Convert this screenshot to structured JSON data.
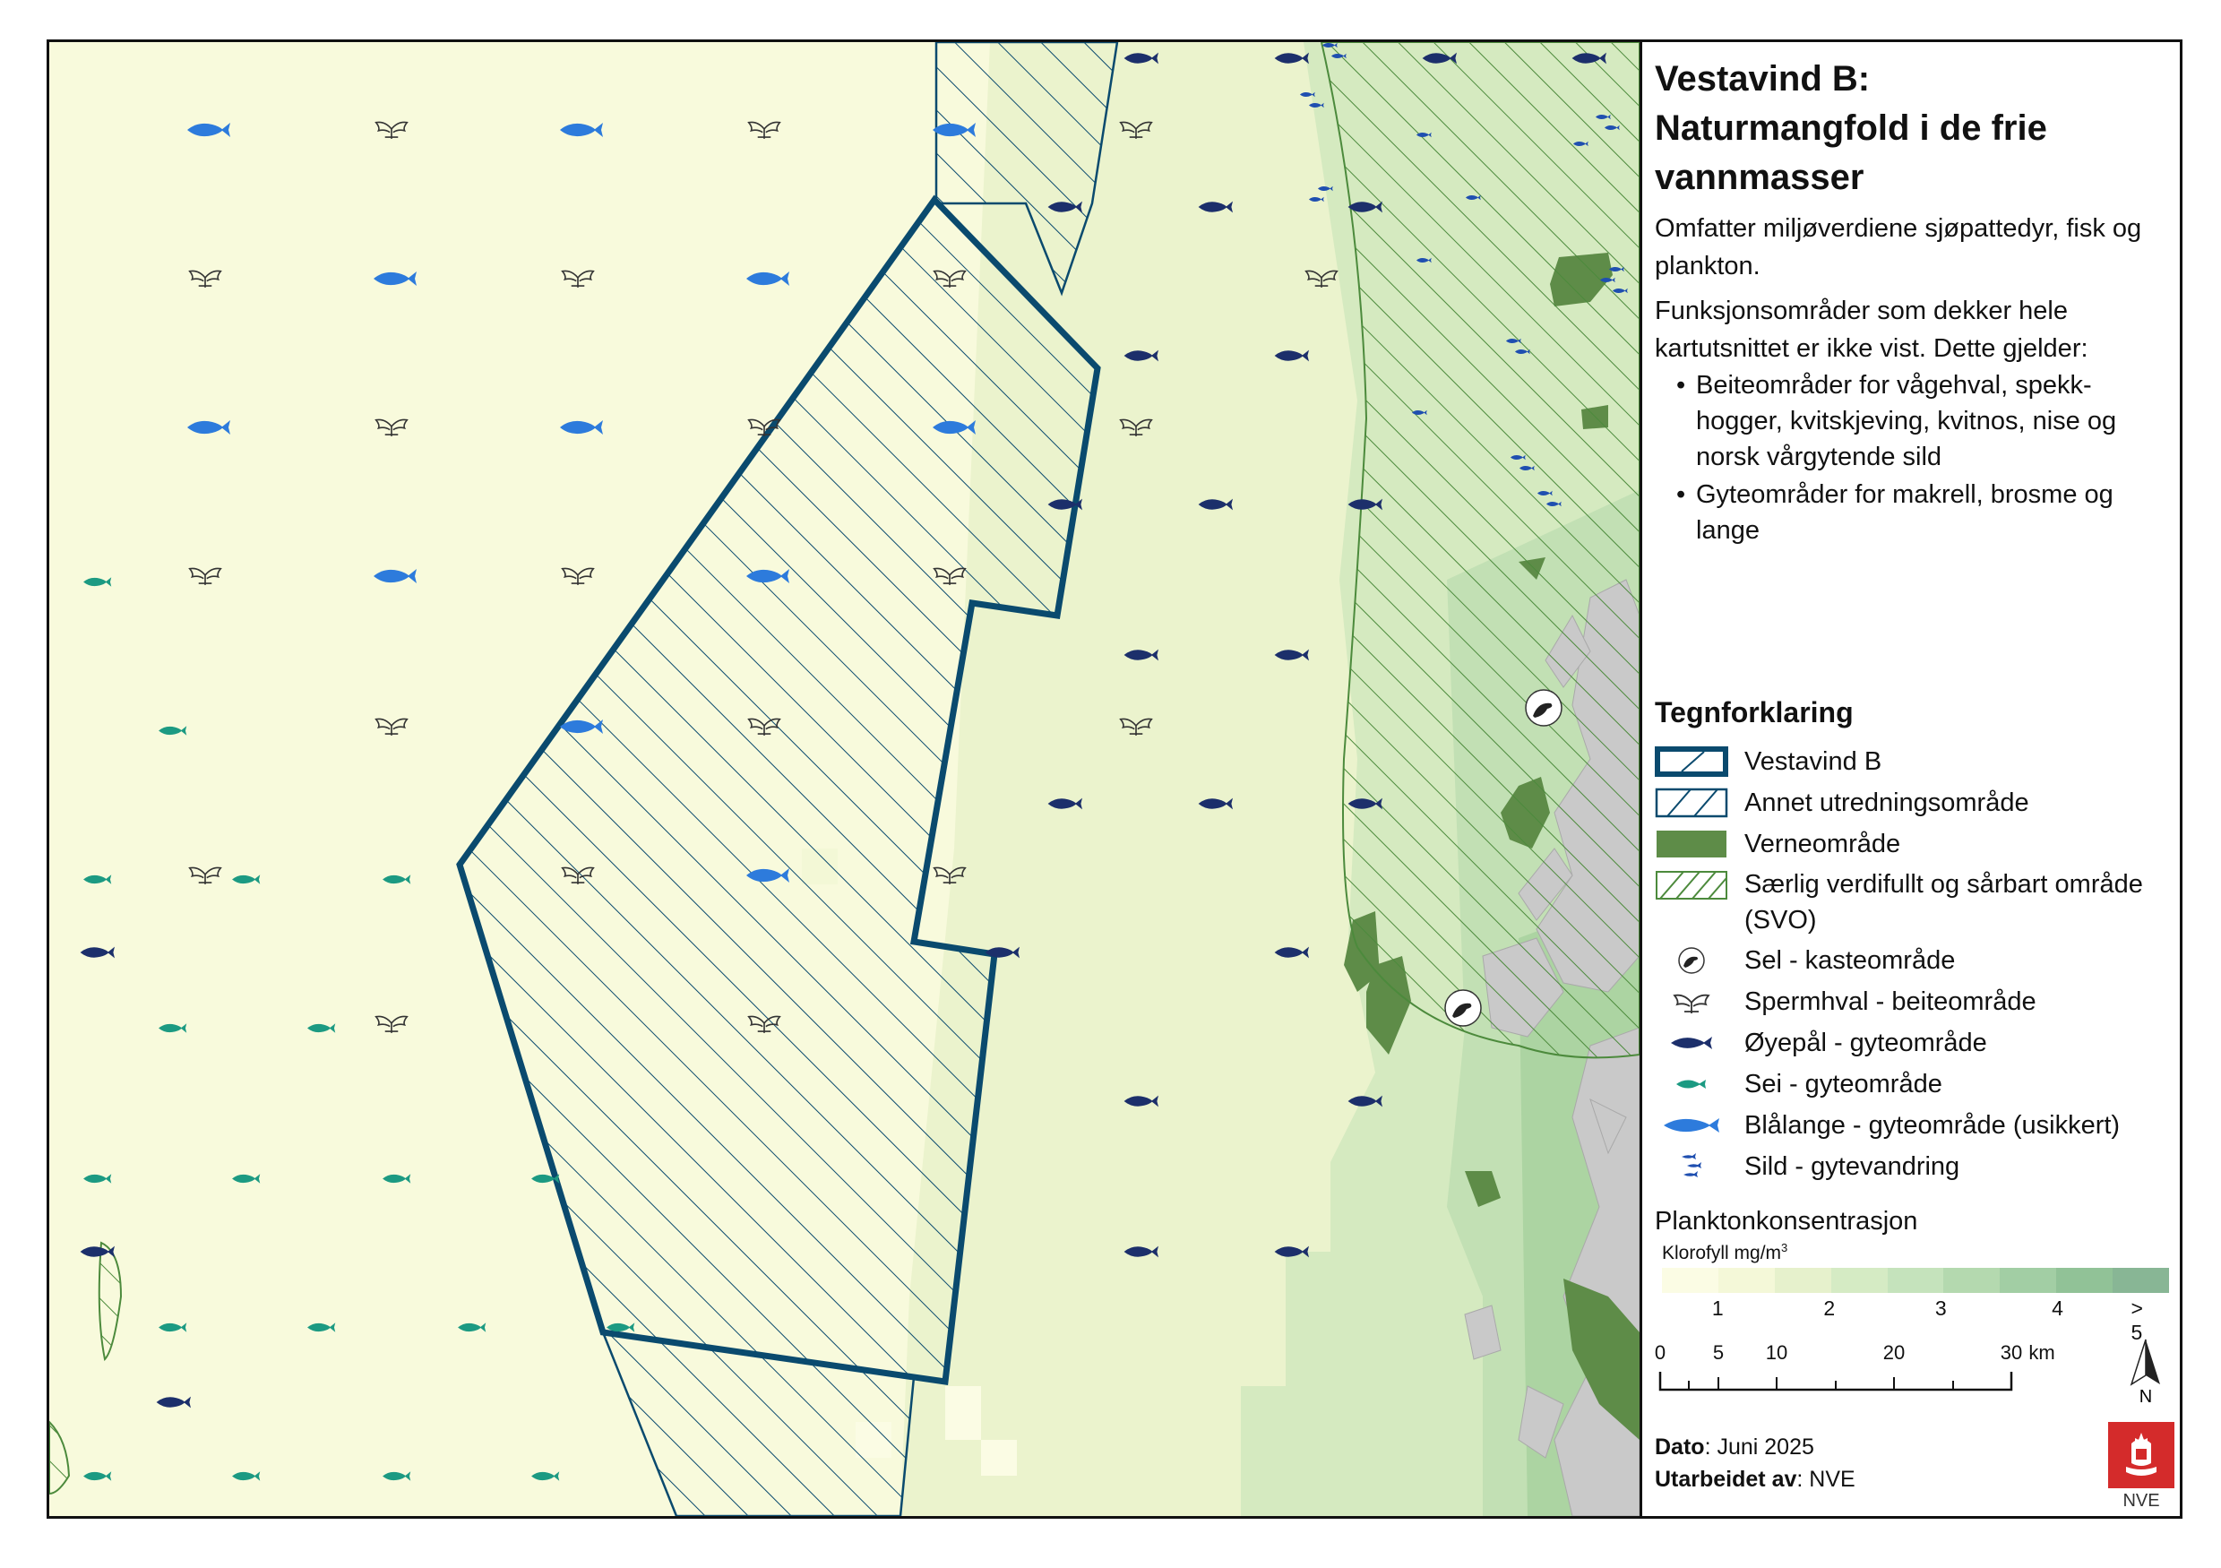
{
  "panel": {
    "title_lines": [
      "Vestavind B:",
      "Naturmangfold i de frie",
      "vannmasser"
    ],
    "description": "Omfatter miljøverdiene sjøpattedyr, fisk og plankton.",
    "note": "Funksjonsområder som dekker hele kartutsnittet er ikke vist. Dette gjelder:",
    "bullets": [
      "Beiteområder for vågehval, spekk-hogger, kvitskjeving, kvitnos, nise og norsk vårgytende sild",
      "Gyteområder for makrell, brosme og lange"
    ]
  },
  "legend": {
    "title": "Tegnforklaring",
    "items": [
      {
        "label": "Vestavind B",
        "symbol": "study-area-thick"
      },
      {
        "label": "Annet utredningsområde",
        "symbol": "study-area-thin"
      },
      {
        "label": "Verneområde",
        "symbol": "protected-fill"
      },
      {
        "label": "Særlig verdifullt og sårbart område (SVO)",
        "symbol": "svo-hatch"
      },
      {
        "label": "Sel - kasteområde",
        "symbol": "seal-icon"
      },
      {
        "label": "Spermhval - beiteområde",
        "symbol": "whale-tail-icon"
      },
      {
        "label": "Øyepål - gyteområde",
        "symbol": "fish-navy-icon"
      },
      {
        "label": "Sei - gyteområde",
        "symbol": "fish-teal-icon"
      },
      {
        "label": "Blålange - gyteområde (usikkert)",
        "symbol": "fish-blue-icon"
      },
      {
        "label": "Sild - gytevandring",
        "symbol": "herring-icon"
      }
    ]
  },
  "plankton": {
    "title": "Planktonkonsentrasjon",
    "unit_label": "Klorofyll mg/m",
    "unit_sup": "3",
    "colors": [
      "#fbfce4",
      "#f4f8d8",
      "#e6f1cc",
      "#d5ebc4",
      "#c5e3bc",
      "#b4d9af",
      "#a2cea4",
      "#91c297",
      "#88b695"
    ],
    "ticks": [
      "1",
      "2",
      "3",
      "4",
      "> 5"
    ]
  },
  "scalebar": {
    "ticks": [
      "0",
      "5",
      "10",
      "20",
      "30"
    ],
    "unit": "km"
  },
  "north": "N",
  "footer": {
    "date_label": "Dato",
    "date_value": ": Juni 2025",
    "author_label": "Utarbeidet av",
    "author_value": ": NVE"
  },
  "logo_text": "NVE",
  "colors": {
    "study_area_stroke": "#0a4a6e",
    "protected": "#5e8c48",
    "svo_hatch": "#4c8a3c",
    "fish_navy": "#1c2f6b",
    "fish_teal": "#1c9a82",
    "fish_blue": "#2d7bdc",
    "logo_red": "#d42b2b"
  }
}
